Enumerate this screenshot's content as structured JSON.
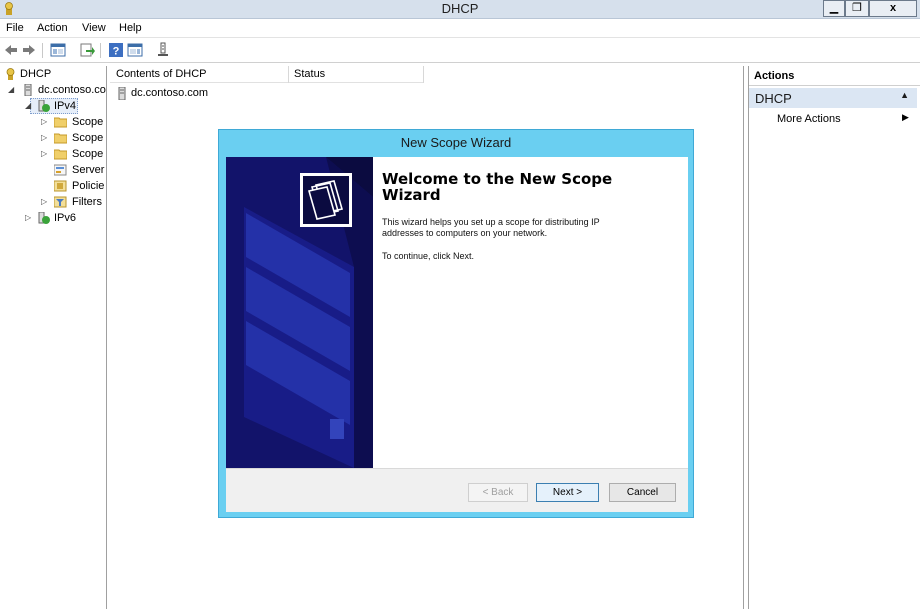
{
  "window": {
    "title": "DHCP",
    "controls": {
      "minimize": "▁",
      "restore": "❐",
      "close": "x"
    }
  },
  "menu": [
    "File",
    "Action",
    "View",
    "Help"
  ],
  "toolbar": {
    "icons": [
      "back-arrow-icon",
      "forward-arrow-icon",
      "show-hide-console-tree-icon",
      "export-list-icon",
      "help-icon",
      "show-hide-action-pane-icon",
      "refresh-icon"
    ]
  },
  "tree": {
    "items": [
      {
        "label": "DHCP",
        "icon": "dhcp-icon",
        "expander": ""
      },
      {
        "label": "dc.contoso.co",
        "icon": "server-icon",
        "expander": "◢"
      },
      {
        "label": "IPv4",
        "icon": "ipv4-icon",
        "expander": "◢"
      },
      {
        "label": "Scope",
        "icon": "folder-icon",
        "expander": "▷"
      },
      {
        "label": "Scope",
        "icon": "folder-icon",
        "expander": "▷"
      },
      {
        "label": "Scope",
        "icon": "folder-icon",
        "expander": "▷"
      },
      {
        "label": "Server",
        "icon": "server-options-icon",
        "expander": ""
      },
      {
        "label": "Policie",
        "icon": "policies-icon",
        "expander": ""
      },
      {
        "label": "Filters",
        "icon": "filter-icon",
        "expander": "▷"
      },
      {
        "label": "IPv6",
        "icon": "ipv6-icon",
        "expander": "▷"
      }
    ]
  },
  "center": {
    "columns": [
      "Contents of DHCP",
      "Status"
    ],
    "rows": [
      {
        "name": "dc.contoso.com",
        "status": ""
      }
    ]
  },
  "actions": {
    "header": "Actions",
    "section": "DHCP",
    "items": [
      "More Actions"
    ]
  },
  "wizard": {
    "title": "New Scope Wizard",
    "heading": "Welcome to the New Scope Wizard",
    "paragraph1": "This wizard helps you set up a scope for distributing IP addresses to computers on your network.",
    "paragraph2": "To continue, click Next.",
    "buttons": {
      "back": "< Back",
      "next": "Next >",
      "cancel": "Cancel"
    },
    "back_enabled": false
  }
}
